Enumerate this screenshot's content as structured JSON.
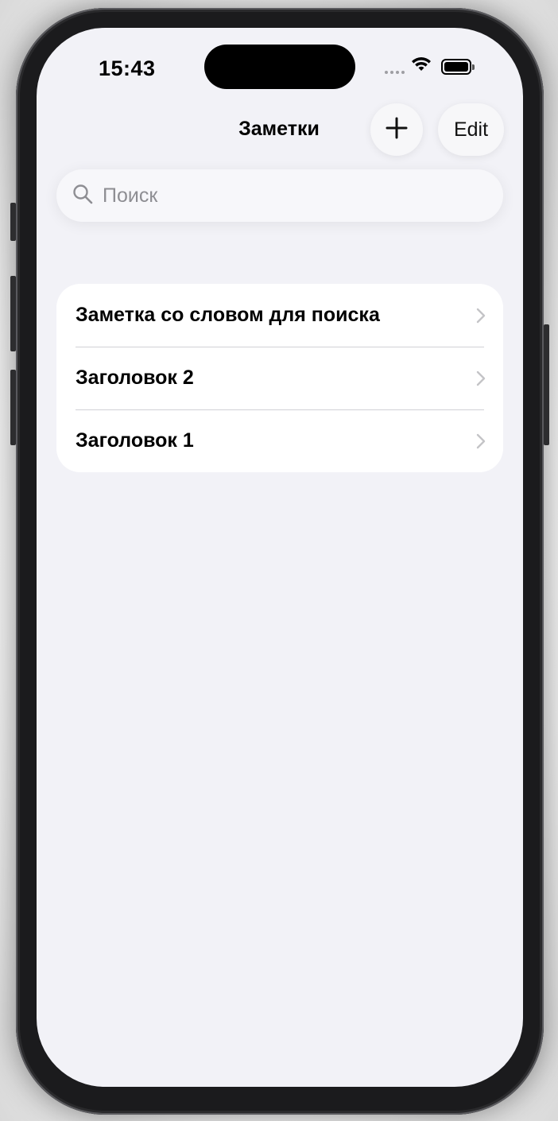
{
  "status_bar": {
    "time": "15:43"
  },
  "nav": {
    "title": "Заметки",
    "add_icon": "plus-icon",
    "edit_label": "Edit"
  },
  "search": {
    "placeholder": "Поиск",
    "value": "",
    "icon": "search-icon"
  },
  "notes": [
    {
      "title": "Заметка со словом для поиска"
    },
    {
      "title": "Заголовок 2"
    },
    {
      "title": "Заголовок 1"
    }
  ],
  "colors": {
    "background": "#f2f2f7",
    "card": "#ffffff",
    "placeholder": "#8e8e93",
    "chevron": "#c4c4c7"
  }
}
